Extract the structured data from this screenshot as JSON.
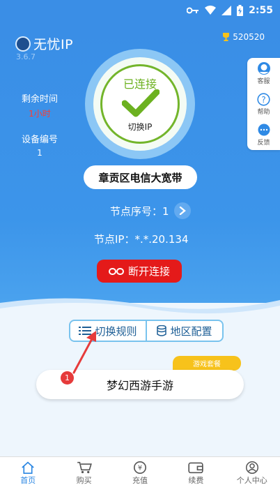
{
  "status_bar": {
    "time": "2:55",
    "icons": [
      "key-icon",
      "wifi-icon",
      "signal-icon",
      "battery-icon"
    ]
  },
  "app": {
    "name": "无忧IP",
    "version": "3.6.7",
    "points": "520520"
  },
  "side_panel": {
    "items": [
      {
        "icon": "customer-service-icon",
        "label": "客服"
      },
      {
        "icon": "help-icon",
        "label": "帮助"
      },
      {
        "icon": "feedback-icon",
        "label": "反馈"
      }
    ]
  },
  "info": {
    "remaining_label": "剩余时间",
    "remaining_value": "1小时",
    "device_label": "设备编号",
    "device_value": "1"
  },
  "connection": {
    "status": "已连接",
    "action": "切换IP",
    "location": "章贡区电信大宽带",
    "node_label": "节点序号：1",
    "node_ip": "节点IP：*.*.20.134",
    "disconnect": "断开连接"
  },
  "toggles": {
    "switch_rule": "切换规则",
    "region_config": "地区配置"
  },
  "game": {
    "tag": "游戏套餐",
    "name": "梦幻西游手游",
    "badge": "1"
  },
  "nav": {
    "items": [
      {
        "icon": "home-icon",
        "label": "首页",
        "active": true
      },
      {
        "icon": "cart-icon",
        "label": "购买",
        "active": false
      },
      {
        "icon": "yuan-icon",
        "label": "充值",
        "active": false
      },
      {
        "icon": "wallet-icon",
        "label": "续费",
        "active": false
      },
      {
        "icon": "user-icon",
        "label": "个人中心",
        "active": false
      }
    ]
  },
  "colors": {
    "primary": "#3a8ee6",
    "success": "#6cb120",
    "danger": "#e41a1a",
    "accent": "#f7c21b"
  }
}
